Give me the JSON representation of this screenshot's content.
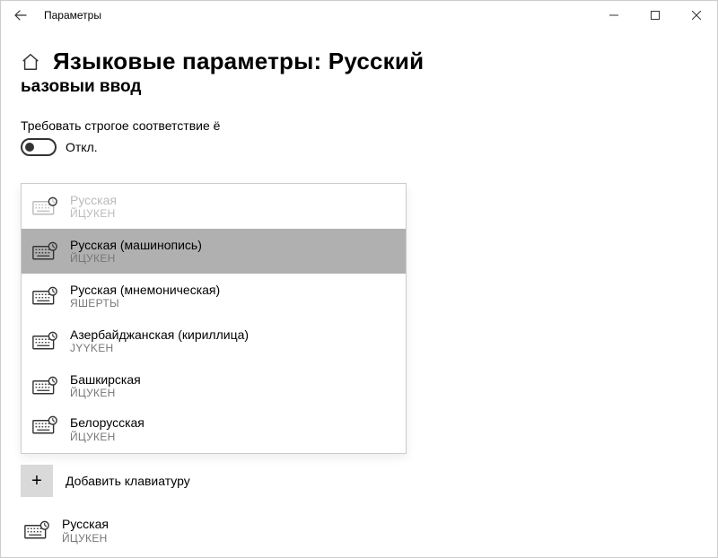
{
  "window": {
    "title": "Параметры"
  },
  "page": {
    "title": "Языковые параметры: Русский",
    "subtitle": "ьазовыи ввод"
  },
  "toggle": {
    "label": "Требовать строгое соответствие ё",
    "state": "Откл."
  },
  "dropdown": {
    "items": [
      {
        "name": "Русская",
        "layout": "ЙЦУКЕН",
        "disabled": true
      },
      {
        "name": "Русская (машинопись)",
        "layout": "ЙЦУКЕН",
        "selected": true
      },
      {
        "name": "Русская (мнемоническая)",
        "layout": "ЯШЕРТЫ"
      },
      {
        "name": "Азербайджанская (кириллица)",
        "layout": "JYYKEH"
      },
      {
        "name": "Башкирская",
        "layout": "ЙЦУКЕН"
      },
      {
        "name": "Белорусская",
        "layout": "ЙЦУКЕН",
        "truncated": true
      }
    ]
  },
  "add": {
    "label": "Добавить клавиатуру"
  },
  "installed": {
    "name": "Русская",
    "layout": "ЙЦУКЕН"
  }
}
